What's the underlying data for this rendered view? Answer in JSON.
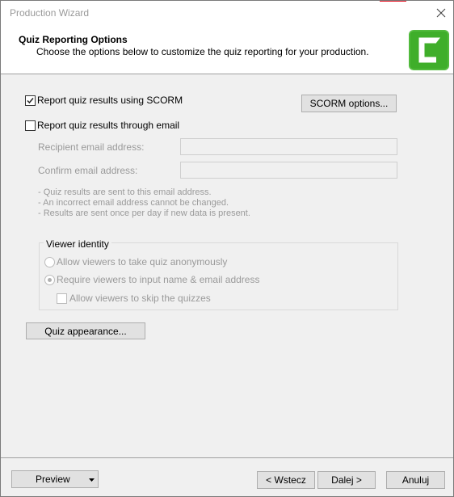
{
  "window": {
    "title": "Production Wizard"
  },
  "header": {
    "title": "Quiz Reporting Options",
    "subtitle": "Choose the options below to customize the quiz reporting for your production."
  },
  "options": {
    "scorm_label": "Report quiz results using SCORM",
    "scorm_checked": true,
    "scorm_button": "SCORM options...",
    "email_label": "Report quiz results through email",
    "email_checked": false,
    "recipient_label": "Recipient email address:",
    "recipient_value": "",
    "confirm_label": "Confirm email address:",
    "confirm_value": "",
    "notes": [
      "-  Quiz results are sent to this email address.",
      "-  An incorrect email address cannot be changed.",
      "-  Results are sent once per day if new data is present."
    ]
  },
  "viewer_identity": {
    "label": "Viewer identity",
    "anonymous_label": "Allow viewers to take quiz anonymously",
    "require_label": "Require viewers to input name & email address",
    "selected": "require",
    "skip_label": "Allow viewers to skip the quizzes",
    "skip_checked": false
  },
  "quiz_appearance_button": "Quiz appearance...",
  "footer": {
    "preview": "Preview",
    "back": "< Wstecz",
    "next": "Dalej >",
    "cancel": "Anuluj"
  },
  "colors": {
    "logo_green": "#3fae2a",
    "text_disabled": "#9a9a9a"
  }
}
